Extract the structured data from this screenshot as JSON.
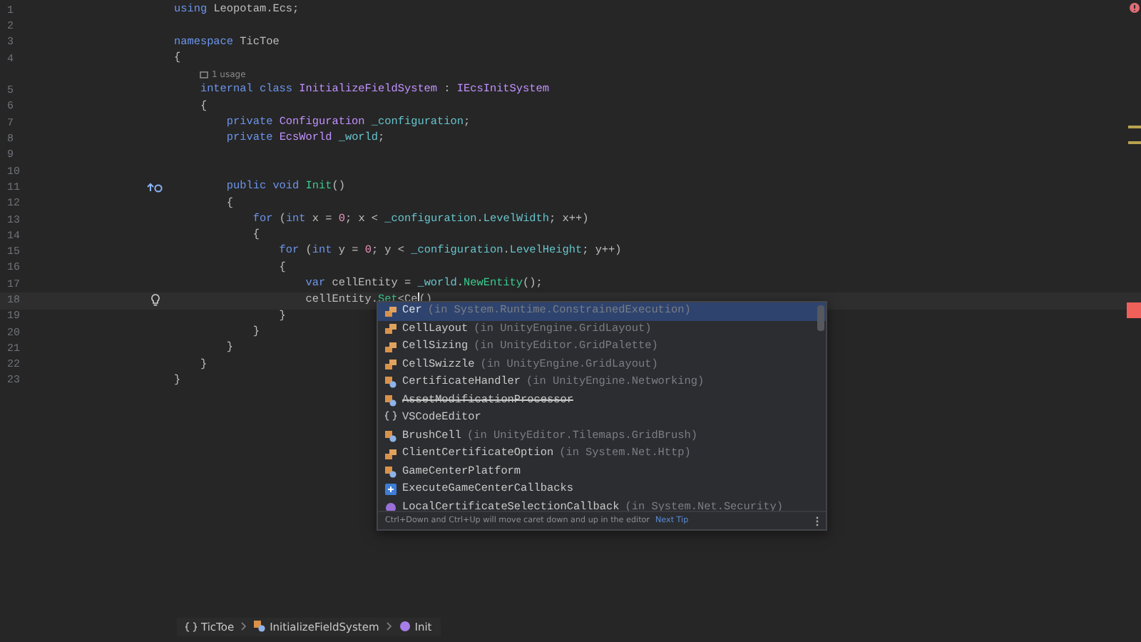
{
  "editor": {
    "lines": [
      {
        "kind": "code",
        "number": "1",
        "tokens": [
          {
            "text": "using",
            "kind": "keyword"
          },
          {
            "text": " Leopotam.Ecs;",
            "kind": "plain"
          }
        ]
      },
      {
        "kind": "code",
        "number": "2"
      },
      {
        "kind": "code",
        "number": "3",
        "tokens": [
          {
            "text": "namespace",
            "kind": "keyword"
          },
          {
            "text": " TicToe",
            "kind": "namespace"
          }
        ]
      },
      {
        "kind": "code",
        "number": "4",
        "tokens": [
          {
            "text": "{",
            "kind": "plain"
          }
        ]
      },
      {
        "kind": "hint",
        "text": "1 usage"
      },
      {
        "kind": "code",
        "number": "5",
        "tokens": [
          {
            "text": "    internal class",
            "kind": "keyword"
          },
          {
            "text": " InitializeFieldSystem",
            "kind": "class"
          },
          {
            "text": " : ",
            "kind": "plain"
          },
          {
            "text": "IEcsInitSystem",
            "kind": "interface"
          }
        ]
      },
      {
        "kind": "code",
        "number": "6",
        "tokens": [
          {
            "text": "    {",
            "kind": "plain"
          }
        ]
      },
      {
        "kind": "code",
        "number": "7",
        "tokens": [
          {
            "text": "        private",
            "kind": "keyword"
          },
          {
            "text": " Configuration",
            "kind": "class"
          },
          {
            "text": " _configuration",
            "kind": "field"
          },
          {
            "text": ";",
            "kind": "plain"
          }
        ]
      },
      {
        "kind": "code",
        "number": "8",
        "tokens": [
          {
            "text": "        private",
            "kind": "keyword"
          },
          {
            "text": " EcsWorld",
            "kind": "class"
          },
          {
            "text": " _world",
            "kind": "field"
          },
          {
            "text": ";",
            "kind": "plain"
          }
        ]
      },
      {
        "kind": "code",
        "number": "9"
      },
      {
        "kind": "code",
        "number": "10"
      },
      {
        "kind": "code",
        "number": "11",
        "gutter": {
          "kind": "implements"
        },
        "tokens": [
          {
            "text": "        public void",
            "kind": "keyword"
          },
          {
            "text": " Init",
            "kind": "method"
          },
          {
            "text": "()",
            "kind": "plain"
          }
        ]
      },
      {
        "kind": "code",
        "number": "12",
        "tokens": [
          {
            "text": "        {",
            "kind": "plain"
          }
        ]
      },
      {
        "kind": "code",
        "number": "13",
        "tokens": [
          {
            "text": "            for",
            "kind": "keyword"
          },
          {
            "text": " (",
            "kind": "plain"
          },
          {
            "text": "int",
            "kind": "keyword"
          },
          {
            "text": " x = ",
            "kind": "plain"
          },
          {
            "text": "0",
            "kind": "number"
          },
          {
            "text": "; x < ",
            "kind": "plain"
          },
          {
            "text": "_configuration",
            "kind": "field"
          },
          {
            "text": ".",
            "kind": "plain"
          },
          {
            "text": "LevelWidth",
            "kind": "field"
          },
          {
            "text": "; x++)",
            "kind": "plain"
          }
        ]
      },
      {
        "kind": "code",
        "number": "14",
        "tokens": [
          {
            "text": "            {",
            "kind": "plain"
          }
        ]
      },
      {
        "kind": "code",
        "number": "15",
        "tokens": [
          {
            "text": "                for",
            "kind": "keyword"
          },
          {
            "text": " (",
            "kind": "plain"
          },
          {
            "text": "int",
            "kind": "keyword"
          },
          {
            "text": " y = ",
            "kind": "plain"
          },
          {
            "text": "0",
            "kind": "number"
          },
          {
            "text": "; y < ",
            "kind": "plain"
          },
          {
            "text": "_configuration",
            "kind": "field"
          },
          {
            "text": ".",
            "kind": "plain"
          },
          {
            "text": "LevelHeight",
            "kind": "field"
          },
          {
            "text": "; y++)",
            "kind": "plain"
          }
        ]
      },
      {
        "kind": "code",
        "number": "16",
        "tokens": [
          {
            "text": "                {",
            "kind": "plain"
          }
        ]
      },
      {
        "kind": "code",
        "number": "17",
        "tokens": [
          {
            "text": "                    var",
            "kind": "keyword"
          },
          {
            "text": " cellEntity = ",
            "kind": "plain"
          },
          {
            "text": "_world",
            "kind": "field"
          },
          {
            "text": ".",
            "kind": "plain"
          },
          {
            "text": "NewEntity",
            "kind": "method"
          },
          {
            "text": "();",
            "kind": "plain"
          }
        ]
      },
      {
        "kind": "code",
        "number": "18",
        "current": true,
        "gutter": {
          "kind": "bulb"
        },
        "tokens": [
          {
            "text": "                    cellEntity.",
            "kind": "plain"
          },
          {
            "text": "Set",
            "kind": "method"
          },
          {
            "text": "<Ce",
            "kind": "plain"
          },
          {
            "kind": "caret"
          },
          {
            "text": "()",
            "kind": "plain"
          }
        ]
      },
      {
        "kind": "code",
        "number": "19",
        "tokens": [
          {
            "text": "                }",
            "kind": "plain"
          }
        ]
      },
      {
        "kind": "code",
        "number": "20",
        "tokens": [
          {
            "text": "            }",
            "kind": "plain"
          }
        ]
      },
      {
        "kind": "code",
        "number": "21",
        "tokens": [
          {
            "text": "        }",
            "kind": "plain"
          }
        ]
      },
      {
        "kind": "code",
        "number": "22",
        "tokens": [
          {
            "text": "    }",
            "kind": "plain"
          }
        ]
      },
      {
        "kind": "code",
        "number": "23",
        "tokens": [
          {
            "text": "}",
            "kind": "plain"
          }
        ]
      }
    ]
  },
  "completion": {
    "items": [
      {
        "name": "Cer",
        "context": "(in System.Runtime.ConstrainedExecution)",
        "kind": "struct",
        "deprecated": false,
        "selected": true
      },
      {
        "name": "CellLayout",
        "context": "(in UnityEngine.GridLayout)",
        "kind": "struct",
        "deprecated": false,
        "selected": false
      },
      {
        "name": "CellSizing",
        "context": "(in UnityEditor.GridPalette)",
        "kind": "struct",
        "deprecated": false,
        "selected": false
      },
      {
        "name": "CellSwizzle",
        "context": "(in UnityEngine.GridLayout)",
        "kind": "struct",
        "deprecated": false,
        "selected": false
      },
      {
        "name": "CertificateHandler",
        "context": "(in UnityEngine.Networking)",
        "kind": "class",
        "deprecated": false,
        "selected": false
      },
      {
        "name": "AssetModificationProcessor",
        "kind": "class",
        "deprecated": true,
        "selected": false
      },
      {
        "name": "VSCodeEditor",
        "kind": "namespace",
        "deprecated": false,
        "selected": false
      },
      {
        "name": "BrushCell",
        "context": "(in UnityEditor.Tilemaps.GridBrush)",
        "kind": "class",
        "deprecated": false,
        "selected": false
      },
      {
        "name": "ClientCertificateOption",
        "context": "(in System.Net.Http)",
        "kind": "struct",
        "deprecated": false,
        "selected": false
      },
      {
        "name": "GameCenterPlatform",
        "kind": "class",
        "deprecated": false,
        "selected": false
      },
      {
        "name": "ExecuteGameCenterCallbacks",
        "kind": "event",
        "deprecated": false,
        "selected": false
      },
      {
        "name": "LocalCertificateSelectionCallback",
        "context": "(in System.Net.Security)",
        "kind": "delegate",
        "deprecated": false,
        "selected": false
      }
    ],
    "tip": "Ctrl+Down and Ctrl+Up will move caret down and up in the editor",
    "tip_link": "Next Tip"
  },
  "breadcrumbs": [
    {
      "label": "TicToe",
      "kind": "namespace"
    },
    {
      "label": "InitializeFieldSystem",
      "kind": "class"
    },
    {
      "label": "Init",
      "kind": "method"
    }
  ]
}
